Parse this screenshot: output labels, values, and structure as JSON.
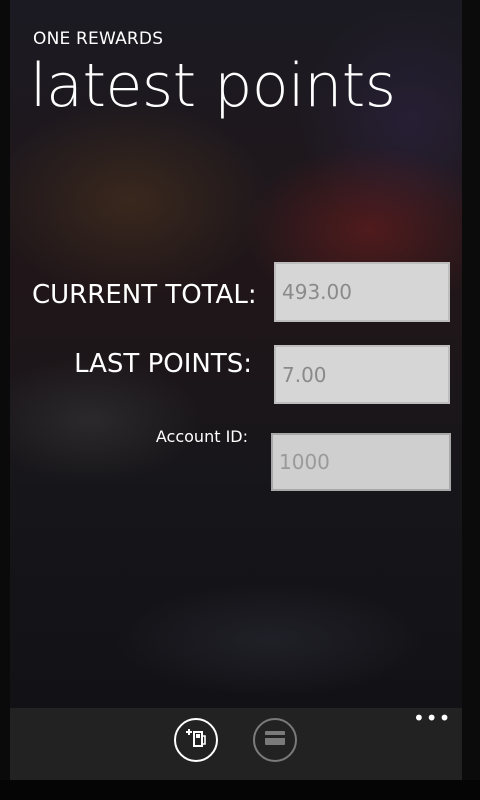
{
  "app": {
    "title": "ONE REWARDS"
  },
  "page": {
    "title": "latest points"
  },
  "fields": {
    "current_total": {
      "label": "CURRENT TOTAL:",
      "value": "493.00"
    },
    "last_points": {
      "label": "LAST POINTS:",
      "value": "7.00"
    },
    "account_id": {
      "label": "Account ID:",
      "value": "1000"
    }
  },
  "app_bar": {
    "buttons": [
      {
        "icon": "add-fuel-icon"
      },
      {
        "icon": "card-icon"
      }
    ],
    "more_label": "•••"
  },
  "colors": {
    "foreground": "#ffffff",
    "field_background": "#d6d6d6",
    "field_text": "#8a8a8a",
    "app_bar_background": "#222222"
  }
}
